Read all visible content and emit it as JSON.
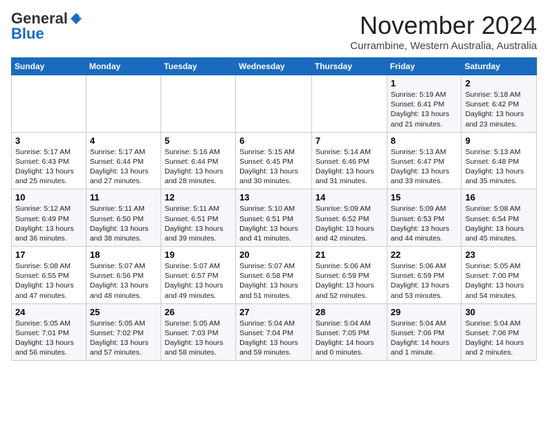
{
  "header": {
    "logo_general": "General",
    "logo_blue": "Blue",
    "month": "November 2024",
    "location": "Currambine, Western Australia, Australia"
  },
  "days_of_week": [
    "Sunday",
    "Monday",
    "Tuesday",
    "Wednesday",
    "Thursday",
    "Friday",
    "Saturday"
  ],
  "weeks": [
    [
      {
        "day": "",
        "info": ""
      },
      {
        "day": "",
        "info": ""
      },
      {
        "day": "",
        "info": ""
      },
      {
        "day": "",
        "info": ""
      },
      {
        "day": "",
        "info": ""
      },
      {
        "day": "1",
        "info": "Sunrise: 5:19 AM\nSunset: 6:41 PM\nDaylight: 13 hours\nand 21 minutes."
      },
      {
        "day": "2",
        "info": "Sunrise: 5:18 AM\nSunset: 6:42 PM\nDaylight: 13 hours\nand 23 minutes."
      }
    ],
    [
      {
        "day": "3",
        "info": "Sunrise: 5:17 AM\nSunset: 6:43 PM\nDaylight: 13 hours\nand 25 minutes."
      },
      {
        "day": "4",
        "info": "Sunrise: 5:17 AM\nSunset: 6:44 PM\nDaylight: 13 hours\nand 27 minutes."
      },
      {
        "day": "5",
        "info": "Sunrise: 5:16 AM\nSunset: 6:44 PM\nDaylight: 13 hours\nand 28 minutes."
      },
      {
        "day": "6",
        "info": "Sunrise: 5:15 AM\nSunset: 6:45 PM\nDaylight: 13 hours\nand 30 minutes."
      },
      {
        "day": "7",
        "info": "Sunrise: 5:14 AM\nSunset: 6:46 PM\nDaylight: 13 hours\nand 31 minutes."
      },
      {
        "day": "8",
        "info": "Sunrise: 5:13 AM\nSunset: 6:47 PM\nDaylight: 13 hours\nand 33 minutes."
      },
      {
        "day": "9",
        "info": "Sunrise: 5:13 AM\nSunset: 6:48 PM\nDaylight: 13 hours\nand 35 minutes."
      }
    ],
    [
      {
        "day": "10",
        "info": "Sunrise: 5:12 AM\nSunset: 6:49 PM\nDaylight: 13 hours\nand 36 minutes."
      },
      {
        "day": "11",
        "info": "Sunrise: 5:11 AM\nSunset: 6:50 PM\nDaylight: 13 hours\nand 38 minutes."
      },
      {
        "day": "12",
        "info": "Sunrise: 5:11 AM\nSunset: 6:51 PM\nDaylight: 13 hours\nand 39 minutes."
      },
      {
        "day": "13",
        "info": "Sunrise: 5:10 AM\nSunset: 6:51 PM\nDaylight: 13 hours\nand 41 minutes."
      },
      {
        "day": "14",
        "info": "Sunrise: 5:09 AM\nSunset: 6:52 PM\nDaylight: 13 hours\nand 42 minutes."
      },
      {
        "day": "15",
        "info": "Sunrise: 5:09 AM\nSunset: 6:53 PM\nDaylight: 13 hours\nand 44 minutes."
      },
      {
        "day": "16",
        "info": "Sunrise: 5:08 AM\nSunset: 6:54 PM\nDaylight: 13 hours\nand 45 minutes."
      }
    ],
    [
      {
        "day": "17",
        "info": "Sunrise: 5:08 AM\nSunset: 6:55 PM\nDaylight: 13 hours\nand 47 minutes."
      },
      {
        "day": "18",
        "info": "Sunrise: 5:07 AM\nSunset: 6:56 PM\nDaylight: 13 hours\nand 48 minutes."
      },
      {
        "day": "19",
        "info": "Sunrise: 5:07 AM\nSunset: 6:57 PM\nDaylight: 13 hours\nand 49 minutes."
      },
      {
        "day": "20",
        "info": "Sunrise: 5:07 AM\nSunset: 6:58 PM\nDaylight: 13 hours\nand 51 minutes."
      },
      {
        "day": "21",
        "info": "Sunrise: 5:06 AM\nSunset: 6:59 PM\nDaylight: 13 hours\nand 52 minutes."
      },
      {
        "day": "22",
        "info": "Sunrise: 5:06 AM\nSunset: 6:59 PM\nDaylight: 13 hours\nand 53 minutes."
      },
      {
        "day": "23",
        "info": "Sunrise: 5:05 AM\nSunset: 7:00 PM\nDaylight: 13 hours\nand 54 minutes."
      }
    ],
    [
      {
        "day": "24",
        "info": "Sunrise: 5:05 AM\nSunset: 7:01 PM\nDaylight: 13 hours\nand 56 minutes."
      },
      {
        "day": "25",
        "info": "Sunrise: 5:05 AM\nSunset: 7:02 PM\nDaylight: 13 hours\nand 57 minutes."
      },
      {
        "day": "26",
        "info": "Sunrise: 5:05 AM\nSunset: 7:03 PM\nDaylight: 13 hours\nand 58 minutes."
      },
      {
        "day": "27",
        "info": "Sunrise: 5:04 AM\nSunset: 7:04 PM\nDaylight: 13 hours\nand 59 minutes."
      },
      {
        "day": "28",
        "info": "Sunrise: 5:04 AM\nSunset: 7:05 PM\nDaylight: 14 hours\nand 0 minutes."
      },
      {
        "day": "29",
        "info": "Sunrise: 5:04 AM\nSunset: 7:06 PM\nDaylight: 14 hours\nand 1 minute."
      },
      {
        "day": "30",
        "info": "Sunrise: 5:04 AM\nSunset: 7:06 PM\nDaylight: 14 hours\nand 2 minutes."
      }
    ]
  ]
}
